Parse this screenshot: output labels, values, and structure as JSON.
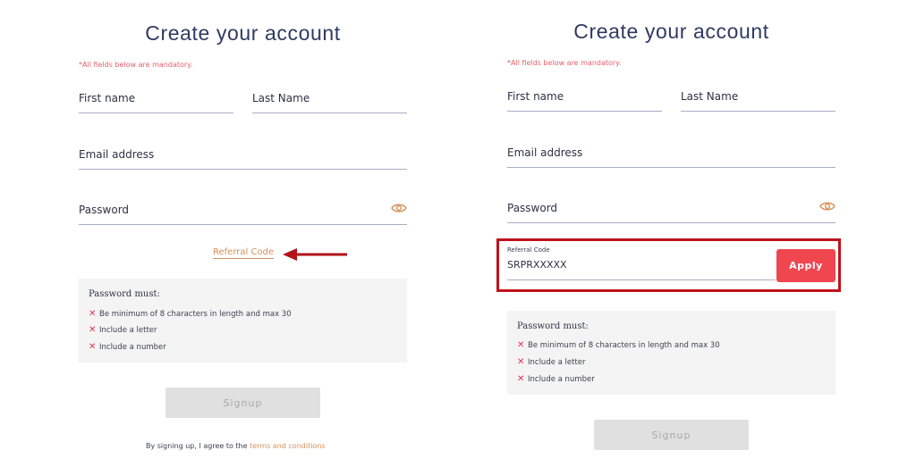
{
  "left": {
    "title": "Create your account",
    "mandatory_note": "*All fields below are mandatory.",
    "fields": {
      "first_name": "First name",
      "last_name": "Last Name",
      "email": "Email address",
      "password": "Password"
    },
    "referral_link": "Referral Code",
    "rules": {
      "heading": "Password must:",
      "items": [
        "Be minimum of 8 characters in length and max 30",
        "Include a letter",
        "Include a number"
      ]
    },
    "signup_label": "Signup",
    "terms": {
      "prefix": "By signing up, I agree to the",
      "link": "terms and conditions"
    }
  },
  "right": {
    "title": "Create your account",
    "mandatory_note": "*All fields below are mandatory.",
    "fields": {
      "first_name": "First name",
      "last_name": "Last Name",
      "email": "Email address",
      "password": "Password"
    },
    "referral": {
      "label": "Referral Code",
      "value": "SRPRXXXXX",
      "apply_label": "Apply"
    },
    "rules": {
      "heading": "Password must:",
      "items": [
        "Be minimum of 8 characters in length and max 30",
        "Include a letter",
        "Include a number"
      ]
    },
    "signup_label": "Signup"
  },
  "colors": {
    "accent": "#d4925a",
    "highlight_box": "#c0121c",
    "apply_button": "#f04650",
    "error_x": "#e2334a"
  },
  "icons": {
    "password_toggle": "eye-icon",
    "rule_status": "x-mark-icon",
    "annotation": "left-arrow-icon"
  }
}
